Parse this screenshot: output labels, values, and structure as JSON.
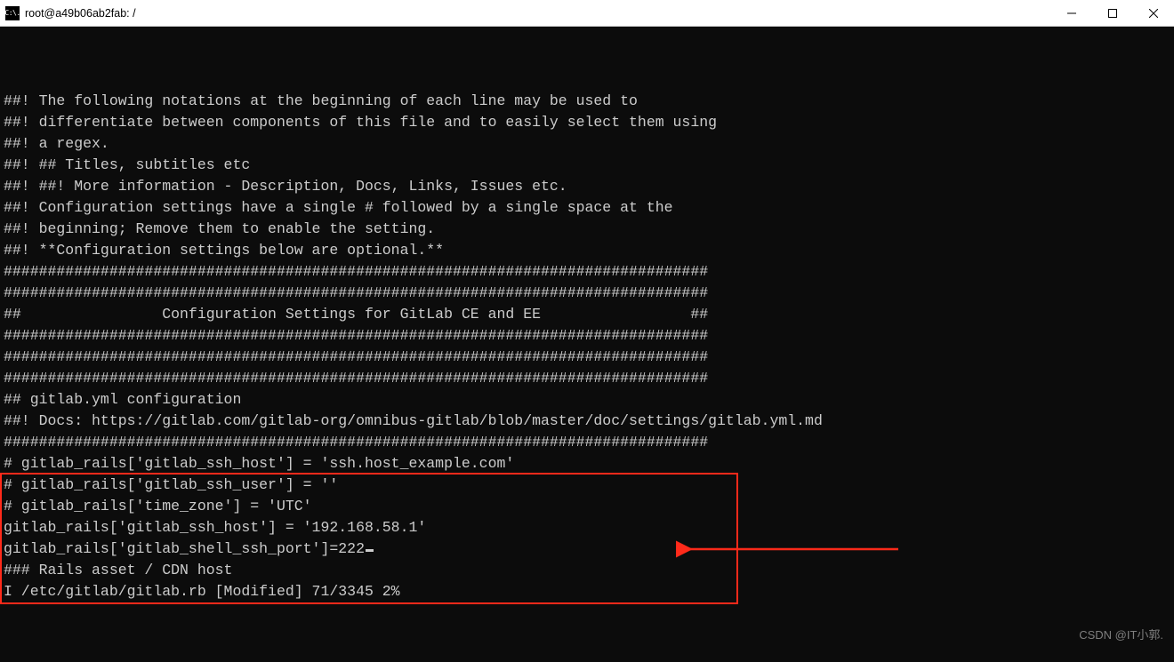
{
  "window": {
    "title": "root@a49b06ab2fab: /",
    "app_icon_label": "C:\\."
  },
  "terminal": {
    "lines": [
      "##! The following notations at the beginning of each line may be used to",
      "##! differentiate between components of this file and to easily select them using",
      "##! a regex.",
      "##! ## Titles, subtitles etc",
      "##! ##! More information - Description, Docs, Links, Issues etc.",
      "##! Configuration settings have a single # followed by a single space at the",
      "##! beginning; Remove them to enable the setting.",
      "",
      "##! **Configuration settings below are optional.**",
      "",
      "",
      "################################################################################",
      "################################################################################",
      "##                Configuration Settings for GitLab CE and EE                 ##",
      "################################################################################",
      "################################################################################",
      "",
      "################################################################################",
      "## gitlab.yml configuration",
      "##! Docs: https://gitlab.com/gitlab-org/omnibus-gitlab/blob/master/doc/settings/gitlab.yml.md",
      "################################################################################",
      "# gitlab_rails['gitlab_ssh_host'] = 'ssh.host_example.com'",
      "# gitlab_rails['gitlab_ssh_user'] = ''",
      "# gitlab_rails['time_zone'] = 'UTC'",
      "gitlab_rails['gitlab_ssh_host'] = '192.168.58.1'",
      "gitlab_rails['gitlab_shell_ssh_port']=222"
    ],
    "tail_lines": [
      "",
      "",
      "### Rails asset / CDN host"
    ],
    "status_line": "I /etc/gitlab/gitlab.rb [Modified] 71/3345 2%"
  },
  "watermark": "CSDN @IT小郭."
}
